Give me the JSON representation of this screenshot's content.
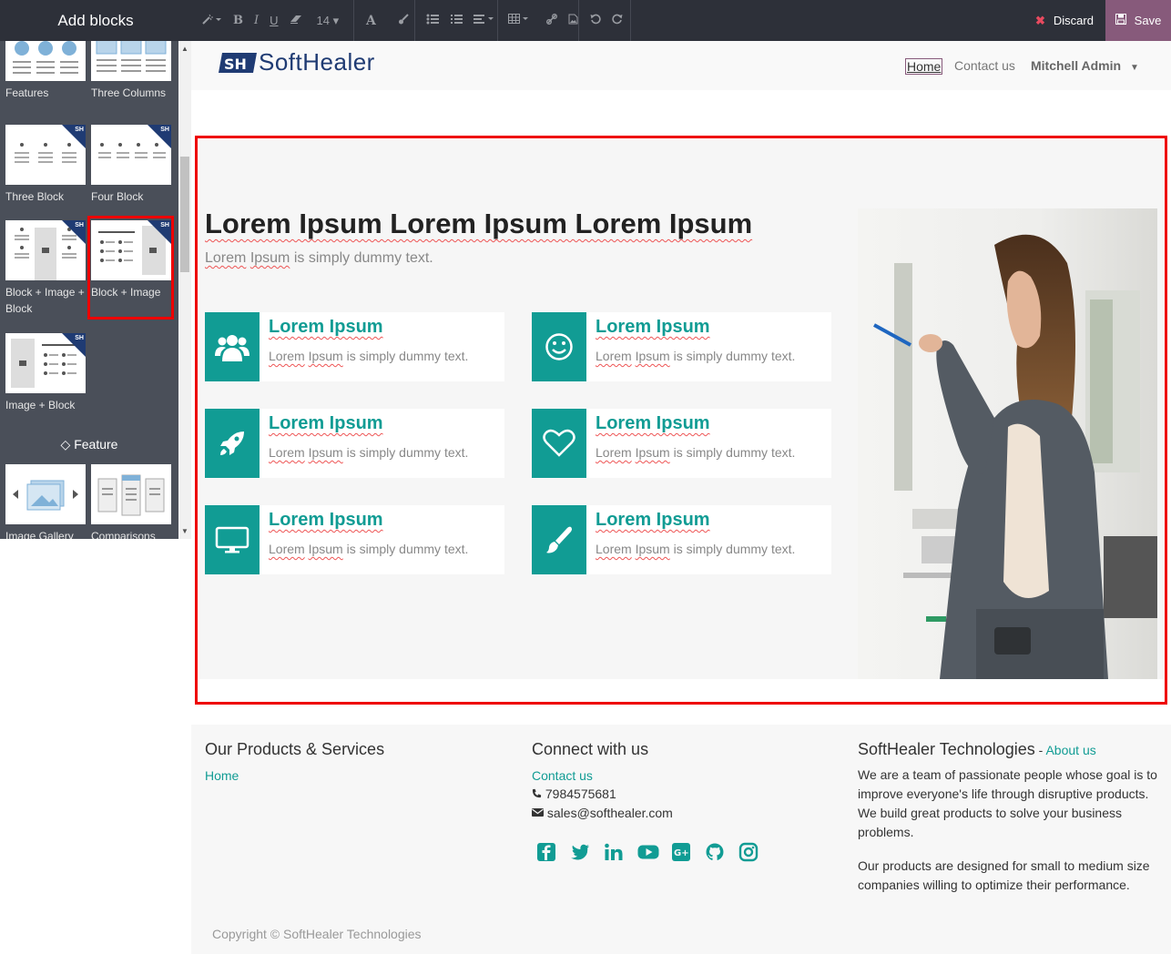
{
  "sidebar": {
    "title": "Add blocks",
    "blocks": [
      {
        "label": "Features"
      },
      {
        "label": "Three Columns"
      },
      {
        "label": "Three Block",
        "badge": "SH"
      },
      {
        "label": "Four Block",
        "badge": "SH"
      },
      {
        "label": "Block + Image + Block",
        "badge": "SH"
      },
      {
        "label": "Block + Image",
        "badge": "SH"
      },
      {
        "label": "Image + Block",
        "badge": "SH"
      },
      {
        "label": "Image Gallery"
      },
      {
        "label": "Comparisons"
      }
    ],
    "section_feature": "Feature"
  },
  "toolbar": {
    "font_size": "14",
    "discard_label": "Discard",
    "save_label": "Save"
  },
  "navbar": {
    "logo": "SoftHealer",
    "logo_mark": "SH",
    "home": "Home",
    "contact": "Contact us",
    "user": "Mitchell Admin"
  },
  "hero": {
    "title": "Lorem Ipsum Lorem Ipsum Lorem Ipsum",
    "subtitle_a": "Lorem",
    "subtitle_b": "Ipsum",
    "subtitle_c": " is simply dummy text."
  },
  "cards": [
    {
      "title": "Lorem Ipsum",
      "icon": "users-icon",
      "desc": "is simply dummy text."
    },
    {
      "title": "Lorem Ipsum",
      "icon": "smile-icon",
      "desc": "is simply dummy text."
    },
    {
      "title": "Lorem Ipsum",
      "icon": "rocket-icon",
      "desc": "is simply dummy text."
    },
    {
      "title": "Lorem Ipsum",
      "icon": "heart-icon",
      "desc": "is simply dummy text."
    },
    {
      "title": "Lorem Ipsum",
      "icon": "desktop-icon",
      "desc": "is simply dummy text."
    },
    {
      "title": "Lorem Ipsum",
      "icon": "paintbrush-icon",
      "desc": "is simply dummy text."
    }
  ],
  "card_desc_a": "Lorem",
  "card_desc_b": "Ipsum",
  "footer": {
    "col1_title": "Our Products & Services",
    "col1_link": "Home",
    "col2_title": "Connect with us",
    "col2_link": "Contact us",
    "phone": "7984575681",
    "email": "sales@softhealer.com",
    "col3_title": "SoftHealer Technologies",
    "col3_dash": " - ",
    "col3_link": "About us",
    "about_p1": "We are a team of passionate people whose goal is to improve everyone's life through disruptive products. We build great products to solve your business problems.",
    "about_p2": "Our products are designed for small to medium size companies willing to optimize their performance.",
    "copyright": "Copyright © SoftHealer Technologies",
    "social": [
      "facebook-icon",
      "twitter-icon",
      "linkedin-icon",
      "youtube-icon",
      "google-plus-icon",
      "github-icon",
      "instagram-icon"
    ]
  },
  "colors": {
    "accent": "#119c94",
    "brand": "#1f3b73",
    "odoo": "#875a7b",
    "highlight": "#e00000"
  }
}
